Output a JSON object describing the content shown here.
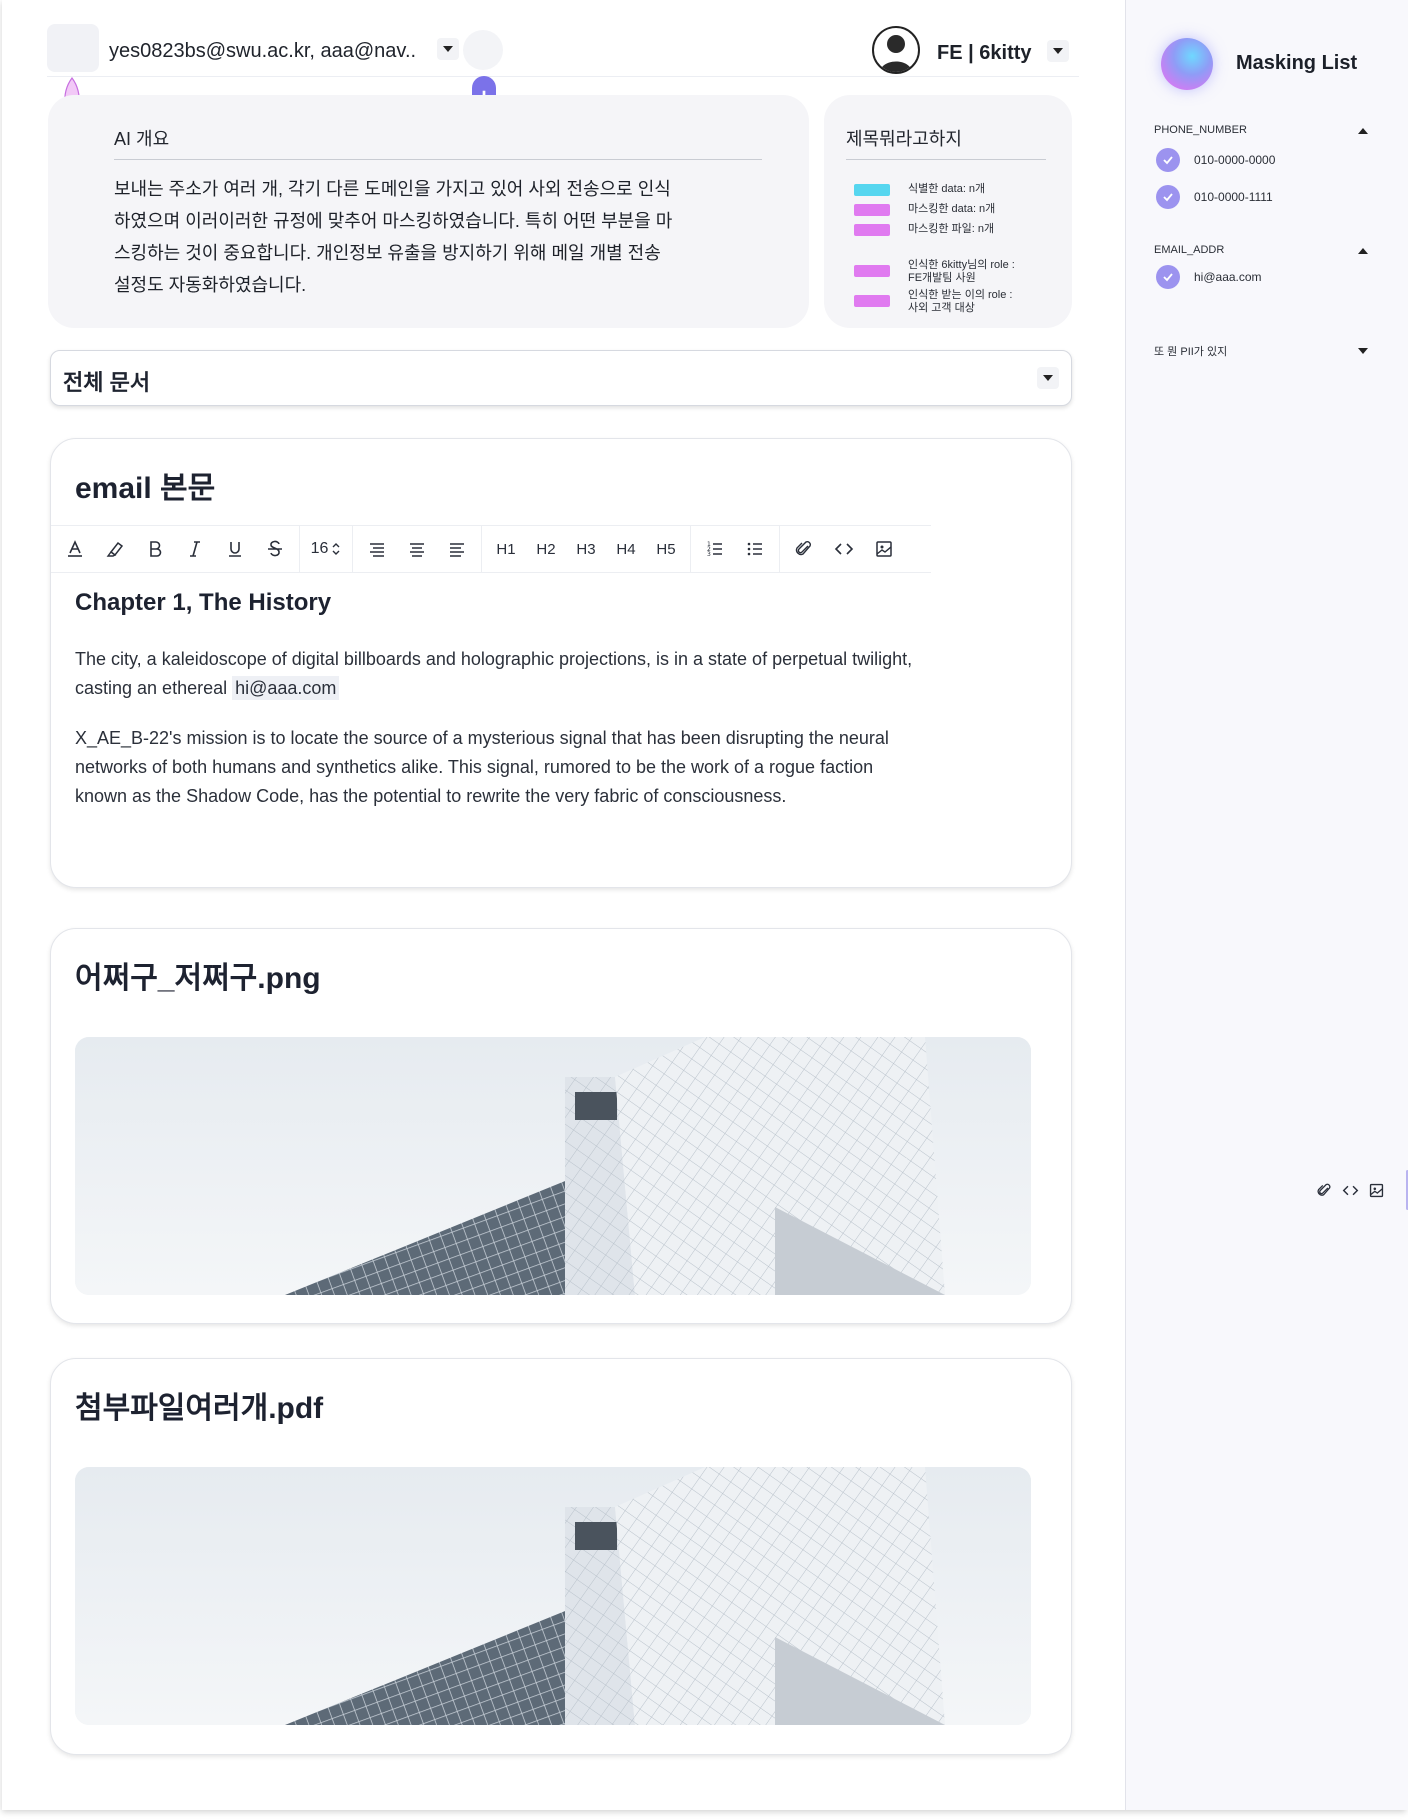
{
  "header": {
    "recipients": "yes0823bs@swu.ac.kr, aaa@nav..",
    "user_label": "FE | 6kitty"
  },
  "ai_summary": {
    "title": "AI 개요",
    "text": "보내는 주소가 여러 개, 각기 다른 도메인을 가지고 있어 사외 전송으로 인식하였으며 이러이러한 규정에 맞추어 마스킹하였습니다. 특히 어떤 부분을 마스킹하는 것이 중요합니다. 개인정보 유출을 방지하기 위해 메일 개별 전송 설정도 자동화하였습니다."
  },
  "legend": {
    "title": "제목뭐라고하지",
    "items": [
      {
        "label": "식별한 data: n개",
        "color": "#56d6ef"
      },
      {
        "label": "마스킹한 data: n개",
        "color": "#e07af0"
      },
      {
        "label": "마스킹한 파일: n개",
        "color": "#e07af0"
      },
      {
        "label": "인식한 6kitty님의 role :\nFE개발팀 사원",
        "color": "#e07af0"
      },
      {
        "label": "인식한 받는 이의 role :\n사외 고객 대상",
        "color": "#e07af0"
      }
    ]
  },
  "document_select": {
    "label": "전체 문서"
  },
  "email_card": {
    "title": "email 본문",
    "font_size": "16",
    "chapter_title": "Chapter 1, The History",
    "para1_text": "The city, a kaleidoscope of digital billboards and holographic projections, is in a state of perpetual twilight, casting an ethereal ",
    "para1_masked": "hi@aaa.com",
    "para2": "X_AE_B-22's mission is to locate the source of a mysterious signal that has been disrupting the neural networks of both humans and synthetics alike. This signal, rumored to be the work of a rogue faction known as the Shadow Code, has the potential to rewrite the very fabric of consciousness."
  },
  "toolbar": {
    "headings": [
      "H1",
      "H2",
      "H3",
      "H4",
      "H5"
    ]
  },
  "attachments": [
    {
      "title": "어쩌구_저쩌구.png"
    },
    {
      "title": "첨부파일여러개.pdf"
    }
  ],
  "masking_list": {
    "title": "Masking List",
    "sections": [
      {
        "name": "PHONE_NUMBER",
        "items": [
          "010-0000-0000",
          "010-0000-1111"
        ],
        "expanded": true
      },
      {
        "name": "EMAIL_ADDR",
        "items": [
          "hi@aaa.com"
        ],
        "expanded": true
      },
      {
        "name": "또 뭔 PII가 있지",
        "items": [],
        "expanded": false
      }
    ]
  },
  "icons": {
    "header": [
      "recipients-dropdown-icon",
      "profile-avatar-icon",
      "user-dropdown-icon",
      "plus-icon"
    ],
    "toolbar": [
      "text-color-icon",
      "highlight-icon",
      "bold-icon",
      "italic-icon",
      "underline-icon",
      "strikethrough-icon",
      "font-size-stepper-icon",
      "align-left-icon",
      "align-center-icon",
      "align-right-icon",
      "ordered-list-icon",
      "bullet-list-icon",
      "attach-icon",
      "code-icon",
      "image-icon"
    ],
    "sidebar": [
      "check-icon",
      "collapse-arrow-icon",
      "expand-arrow-icon"
    ]
  },
  "colors": {
    "accent": "#7b72e9",
    "check": "#9c93ef",
    "legend_cyan": "#56d6ef",
    "legend_magenta": "#e07af0",
    "card_bg": "#f5f5f8"
  }
}
